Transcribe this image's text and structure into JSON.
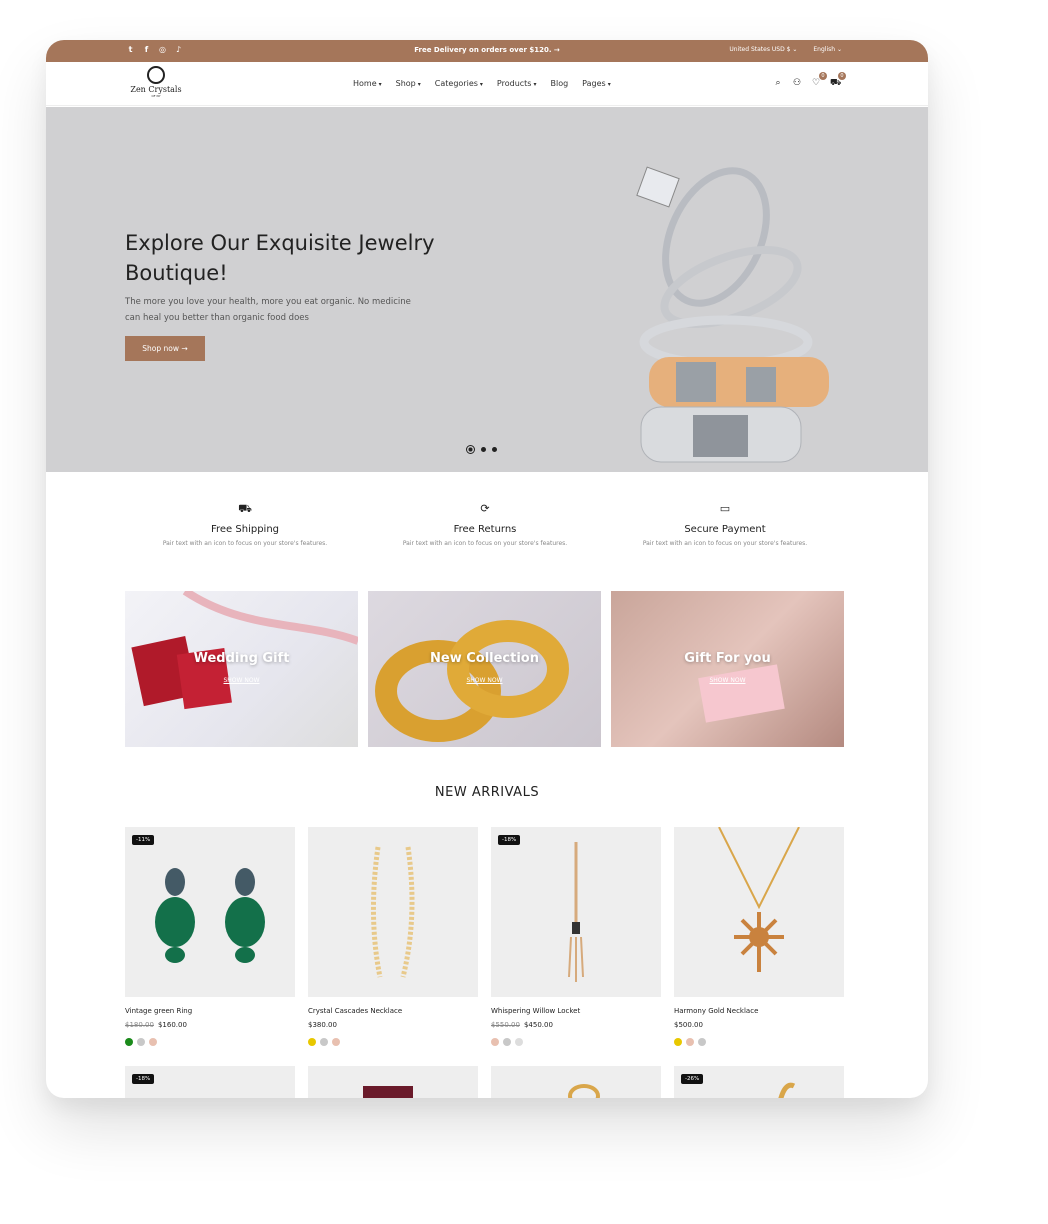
{
  "topbar": {
    "socials": [
      "twitter-icon",
      "facebook-icon",
      "instagram-icon",
      "tiktok-icon"
    ],
    "announcement": "Free Delivery on orders over $120.",
    "currency": "United States USD $",
    "language": "English",
    "bg_color": "#a5765a"
  },
  "header": {
    "logo_name": "Zen Crystals",
    "logo_sub": "OF NY",
    "nav": [
      {
        "label": "Home",
        "has_dropdown": true
      },
      {
        "label": "Shop",
        "has_dropdown": true
      },
      {
        "label": "Categories",
        "has_dropdown": true
      },
      {
        "label": "Products",
        "has_dropdown": true
      },
      {
        "label": "Blog",
        "has_dropdown": false
      },
      {
        "label": "Pages",
        "has_dropdown": true
      }
    ],
    "wishlist_count": "0",
    "cart_count": "0"
  },
  "hero": {
    "title": "Explore Our Exquisite Jewelry Boutique!",
    "text": "The more you love your health, more you eat organic. No medicine can heal you better than organic food does",
    "button": "Shop now",
    "slides": 3,
    "active_slide": 1
  },
  "features": [
    {
      "icon": "truck-icon",
      "title": "Free Shipping",
      "text": "Pair text with an icon to focus on your store's features."
    },
    {
      "icon": "refresh-icon",
      "title": "Free Returns",
      "text": "Pair text with an icon to focus on your store's features."
    },
    {
      "icon": "credit-card-icon",
      "title": "Secure Payment",
      "text": "Pair text with an icon to focus on your store's features."
    }
  ],
  "collections": [
    {
      "title": "Wedding Gift",
      "link": "SHOW NOW"
    },
    {
      "title": "New Collection",
      "link": "SHOW NOW"
    },
    {
      "title": "Gift For you",
      "link": "SHOW NOW"
    }
  ],
  "new_arrivals": {
    "title": "NEW ARRIVALS",
    "products": [
      {
        "name": "Vintage green Ring",
        "old_price": "$180.00",
        "price": "$160.00",
        "badge": "-11%",
        "swatches": [
          "#1a8a1a",
          "#c8c8c8",
          "#e8c0b0"
        ]
      },
      {
        "name": "Crystal Cascades Necklace",
        "old_price": "",
        "price": "$380.00",
        "badge": "",
        "swatches": [
          "#e8c800",
          "#c8c8c8",
          "#e8c0b0"
        ]
      },
      {
        "name": "Whispering Willow Locket",
        "old_price": "$550.00",
        "price": "$450.00",
        "badge": "-18%",
        "swatches": [
          "#e8c0b0",
          "#c8c8c8",
          "#dddddd"
        ]
      },
      {
        "name": "Harmony Gold Necklace",
        "old_price": "",
        "price": "$500.00",
        "badge": "",
        "swatches": [
          "#e8c800",
          "#e8c0b0",
          "#c8c8c8"
        ]
      }
    ],
    "row2_badges": [
      "-18%",
      "",
      "",
      "-26%"
    ]
  }
}
